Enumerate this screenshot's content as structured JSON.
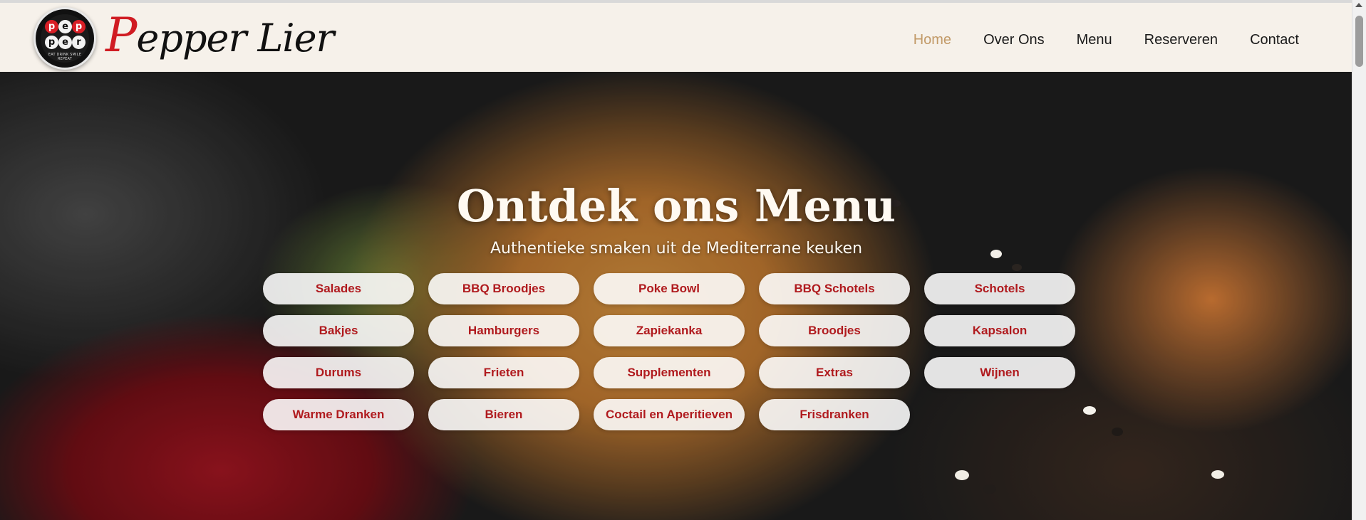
{
  "brand": {
    "first_letter": "P",
    "rest": "epper Lier",
    "logo_letters": [
      "p",
      "e",
      "p",
      "p",
      "e",
      "r"
    ],
    "logo_tagline": "EAT DRINK SMILE REPEAT"
  },
  "nav": {
    "items": [
      {
        "label": "Home",
        "active": true
      },
      {
        "label": "Over Ons",
        "active": false
      },
      {
        "label": "Menu",
        "active": false
      },
      {
        "label": "Reserveren",
        "active": false
      },
      {
        "label": "Contact",
        "active": false
      }
    ]
  },
  "hero": {
    "title": "Ontdek ons Menu",
    "subtitle": "Authentieke smaken uit de Mediterrane keuken"
  },
  "menu_categories": [
    "Salades",
    "BBQ Broodjes",
    "Poke Bowl",
    "BBQ Schotels",
    "Schotels",
    "Bakjes",
    "Hamburgers",
    "Zapiekanka",
    "Broodjes",
    "Kapsalon",
    "Durums",
    "Frieten",
    "Supplementen",
    "Extras",
    "Wijnen",
    "Warme Dranken",
    "Bieren",
    "Coctail en Aperitieven",
    "Frisdranken"
  ],
  "colors": {
    "accent": "#c29a68",
    "brand_red": "#d01c23",
    "pill_text": "#b01a1e",
    "navbar_bg": "#f6f1ea"
  }
}
